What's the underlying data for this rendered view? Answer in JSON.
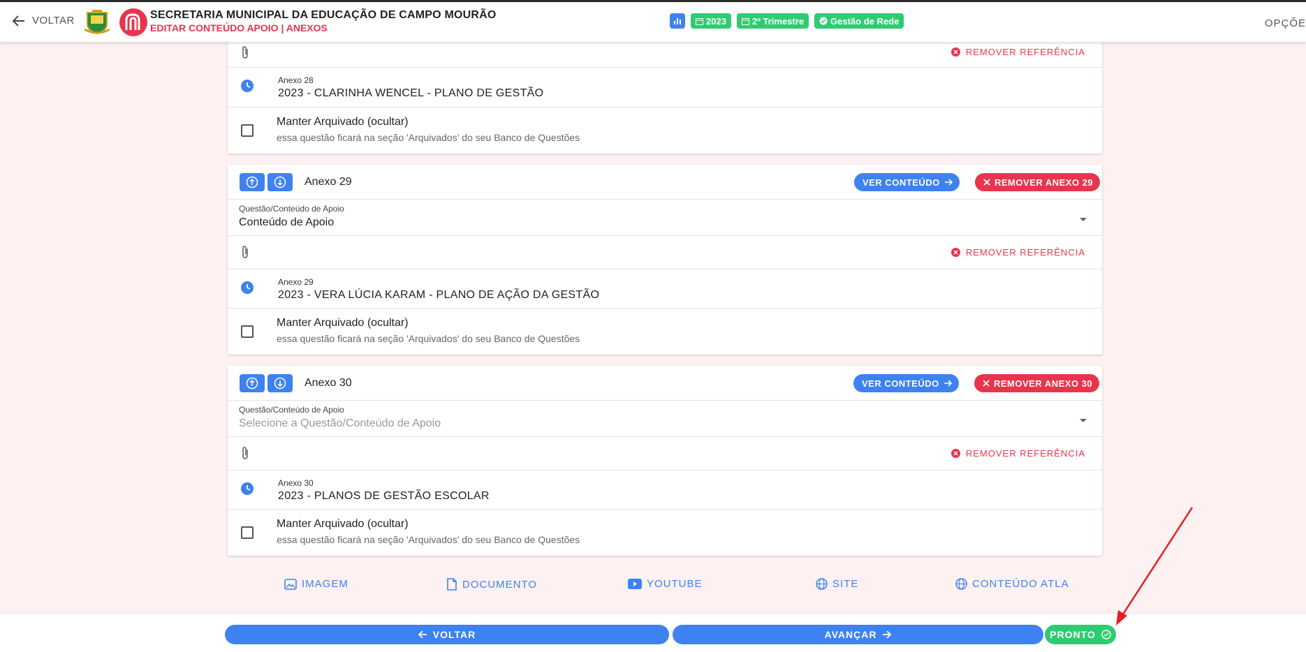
{
  "header": {
    "back_label": "VOLTAR",
    "org_title": "SECRETARIA MUNICIPAL DA EDUCAÇÃO DE CAMPO MOURÃO",
    "page_subtitle": "EDITAR CONTEÚDO APOIO | ANEXOS",
    "badges": {
      "year": "2023",
      "trimester": "2º Trimestre",
      "network": "Gestão de Rede"
    },
    "options_label": "OPÇÕE"
  },
  "labels": {
    "select_label": "Questão/Conteúdo de Apoio",
    "remove_reference": "REMOVER REFERÊNCIA",
    "archive_title": "Manter Arquivado (ocultar)",
    "archive_sub": "essa questão ficará na seção 'Arquivados' do seu Banco de Questões",
    "view_content": "VER CONTEÚDO"
  },
  "partial_card": {
    "anexo_small": "Anexo 28",
    "anexo_name": "2023 - CLARINHA WENCEL - PLANO DE GESTÃO"
  },
  "cards": [
    {
      "title": "Anexo 29",
      "remove_label": "REMOVER ANEXO 29",
      "select_value": "Conteúdo de Apoio",
      "anexo_small": "Anexo 29",
      "anexo_name": "2023 - VERA LÚCIA KARAM - PLANO DE AÇÃO DA GESTÃO"
    },
    {
      "title": "Anexo 30",
      "remove_label": "REMOVER ANEXO 30",
      "select_placeholder": "Selecione a Questão/Conteúdo de Apoio",
      "anexo_small": "Anexo 30",
      "anexo_name": "2023 - PLANOS DE GESTÃO ESCOLAR"
    }
  ],
  "media": {
    "image": "IMAGEM",
    "document": "DOCUMENTO",
    "youtube": "YOUTUBE",
    "site": "SITE",
    "atla": "CONTEÚDO ATLA"
  },
  "footer": {
    "back": "VOLTAR",
    "next": "AVANÇAR",
    "done": "PRONTO"
  },
  "colors": {
    "primary": "#3d82f0",
    "danger": "#e8354d",
    "success": "#2ecc71",
    "background": "#fdf1f1"
  }
}
